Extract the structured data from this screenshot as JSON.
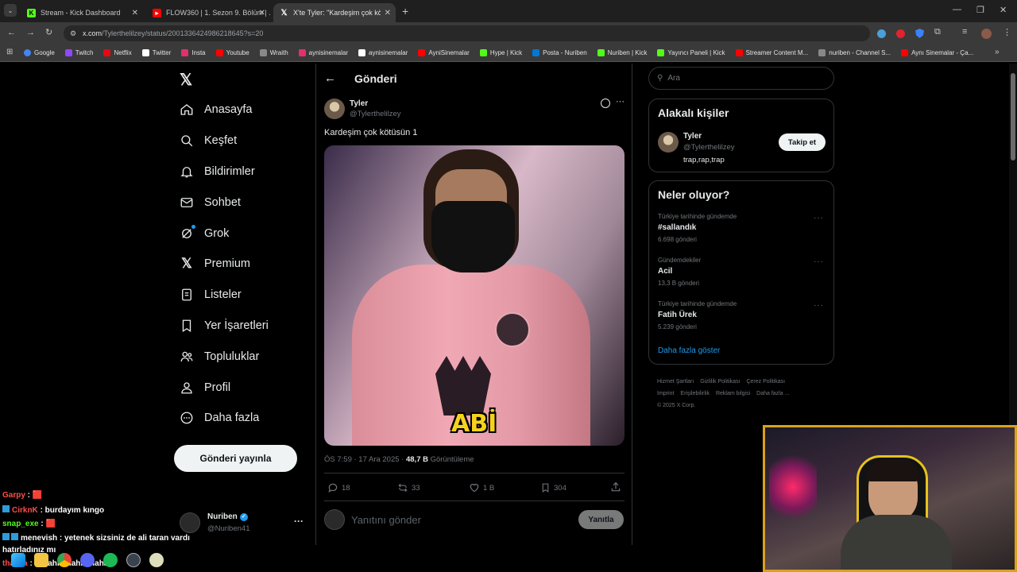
{
  "browser": {
    "tabs": [
      {
        "title": "Stream - Kick Dashboard",
        "icon": "kick-icon",
        "color": "#53fc18"
      },
      {
        "title": "FLOW360 | 1. Sezon 9. Bölüm | ...",
        "icon": "youtube-icon",
        "color": "#ff0000"
      },
      {
        "title": "X'te Tyler: \"Kardeşim çok kö...",
        "icon": "x-icon",
        "color": "#ffffff"
      }
    ],
    "url_host": "x.com",
    "url_path": "/Tylerthelilzey/status/2001336424986218645?s=20",
    "bookmarks": [
      {
        "label": "Google",
        "color": "#4285f4"
      },
      {
        "label": "Twitch",
        "color": "#9146ff"
      },
      {
        "label": "Netflix",
        "color": "#e50914"
      },
      {
        "label": "Twitter",
        "color": "#ffffff"
      },
      {
        "label": "Insta",
        "color": "#e1306c"
      },
      {
        "label": "Youtube",
        "color": "#ff0000"
      },
      {
        "label": "Wraith",
        "color": "#888888"
      },
      {
        "label": "aynisinemalar",
        "color": "#e1306c"
      },
      {
        "label": "aynisinemalar",
        "color": "#ffffff"
      },
      {
        "label": "AyniSinemalar",
        "color": "#ff0000"
      },
      {
        "label": "Hype | Kick",
        "color": "#53fc18"
      },
      {
        "label": "Posta - Nuriben",
        "color": "#0078d4"
      },
      {
        "label": "Nuriben | Kick",
        "color": "#53fc18"
      },
      {
        "label": "Yayıncı Paneli | Kick",
        "color": "#53fc18"
      },
      {
        "label": "Streamer Content M...",
        "color": "#ff0000"
      },
      {
        "label": "nuriben - Channel S...",
        "color": "#888888"
      },
      {
        "label": "Aynı Sinemalar - Ça...",
        "color": "#ff0000"
      }
    ]
  },
  "sidebar": {
    "items": [
      {
        "label": "Anasayfa",
        "icon": "home-icon"
      },
      {
        "label": "Keşfet",
        "icon": "search-icon"
      },
      {
        "label": "Bildirimler",
        "icon": "bell-icon"
      },
      {
        "label": "Sohbet",
        "icon": "mail-icon"
      },
      {
        "label": "Grok",
        "icon": "grok-icon"
      },
      {
        "label": "Premium",
        "icon": "x-icon"
      },
      {
        "label": "Listeler",
        "icon": "list-icon"
      },
      {
        "label": "Yer İşaretleri",
        "icon": "bookmark-icon"
      },
      {
        "label": "Topluluklar",
        "icon": "people-icon"
      },
      {
        "label": "Profil",
        "icon": "person-icon"
      },
      {
        "label": "Daha fazla",
        "icon": "more-circle-icon"
      }
    ],
    "post_button": "Gönderi yayınla",
    "account": {
      "name": "Nuriben",
      "handle": "@Nuriben41"
    }
  },
  "post": {
    "header": "Gönderi",
    "author": "Tyler",
    "handle": "@Tylerthelilzey",
    "text": "Kardeşim çok kötüsün 1",
    "media_caption": "ABİ",
    "time": "ÖS 7:59 · 17 Ara 2025 · ",
    "views": "48,7 B",
    "views_label": " Görüntüleme",
    "stats": {
      "replies": "18",
      "reposts": "33",
      "likes": "1 B",
      "bookmarks": "304"
    },
    "reply_placeholder": "Yanıtını gönder",
    "reply_button": "Yanıtla"
  },
  "right": {
    "search_placeholder": "Ara",
    "relevant_title": "Alakalı kişiler",
    "relevant": {
      "name": "Tyler",
      "handle": "@Tylerthelilzey",
      "bio": "trap,rap,trap",
      "follow": "Takip et"
    },
    "trends_title": "Neler oluyor?",
    "trends": [
      {
        "context": "Türkiye tarihinde gündemde",
        "name": "#sallandık",
        "count": "6.698 gönderi"
      },
      {
        "context": "Gündemdekiler",
        "name": "Acil",
        "count": "13,3 B gönderi"
      },
      {
        "context": "Türkiye tarihinde gündemde",
        "name": "Fatih Ürek",
        "count": "5.239 gönderi"
      }
    ],
    "show_more": "Daha fazla göster",
    "footer": [
      "Hizmet Şartları",
      "Gizlilik Politikası",
      "Çerez Politikası",
      "Imprint",
      "Erişilebilirlik",
      "Reklam bilgisi",
      "Daha fazla ...",
      "© 2025 X Corp."
    ]
  },
  "chat": [
    {
      "user": "Garpy",
      "color": "#ff4d4d",
      "msg": " : 🟥"
    },
    {
      "user": "CirknK",
      "color": "#ff4d4d",
      "msg": " : burdayım kıngo"
    },
    {
      "user": "snap_exe",
      "color": "#53fc18",
      "msg": " : 🟥"
    },
    {
      "user": "menevish",
      "color": "#ffffff",
      "msg": " : yetenek sizsiniz de ali taran vardı"
    },
    {
      "user": "",
      "color": "#ffffff",
      "msg": "hatırladınız mı"
    },
    {
      "user": "thaMia",
      "color": "#ff4d4d",
      "msg": " : ayyahhahahhahaha"
    }
  ]
}
